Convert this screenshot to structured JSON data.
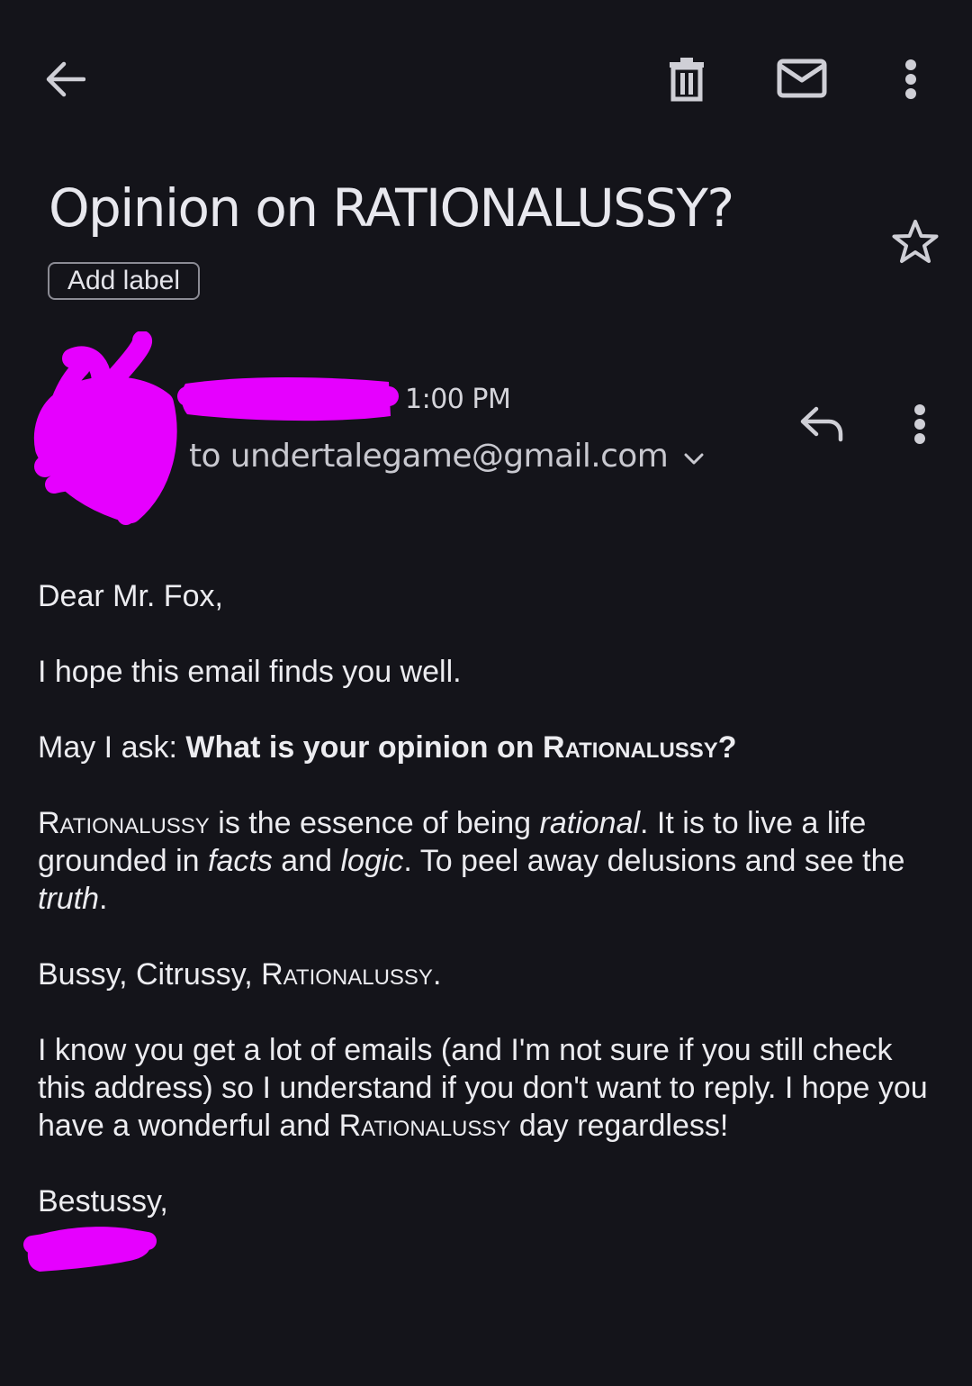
{
  "toolbar": {
    "back_icon": "arrow-left-icon",
    "delete_icon": "trash-icon",
    "mark_unread_icon": "mail-icon",
    "more_icon": "more-vert-icon"
  },
  "email": {
    "subject": "Opinion on RATIONALUSSY?",
    "add_label": "Add label",
    "time": "1:00 PM",
    "recipient": "to undertalegame@gmail.com",
    "body": {
      "greeting": "Dear Mr. Fox,",
      "p1": "I hope this email finds you well.",
      "p2_intro": "May I ask: ",
      "p2_bold_a": "What is your opinion on ",
      "p2_bold_sc": "Rationalussy",
      "p2_bold_end": "?",
      "p3_sc": "Rationalussy",
      "p3_a": " is the essence of being ",
      "p3_i1": "rational",
      "p3_b": ". It is to live a life grounded in ",
      "p3_i2": "facts",
      "p3_c": " and ",
      "p3_i3": "logic",
      "p3_d": ". To peel away delusions and see the ",
      "p3_i4": "truth",
      "p3_e": ".",
      "p4_a": "Bussy, Citrussy, ",
      "p4_sc": "Rationalussy.",
      "p5_a": "I know you get a lot of emails (and I'm not sure if you still check this address) so I understand if you don't want to reply. I hope you have a wonderful and ",
      "p5_sc": "Rationalussy",
      "p5_b": " day regardless!",
      "signoff": "Bestussy,"
    }
  },
  "colors": {
    "background": "#14141a",
    "redaction": "#e600ff",
    "text": "#ececf0"
  }
}
